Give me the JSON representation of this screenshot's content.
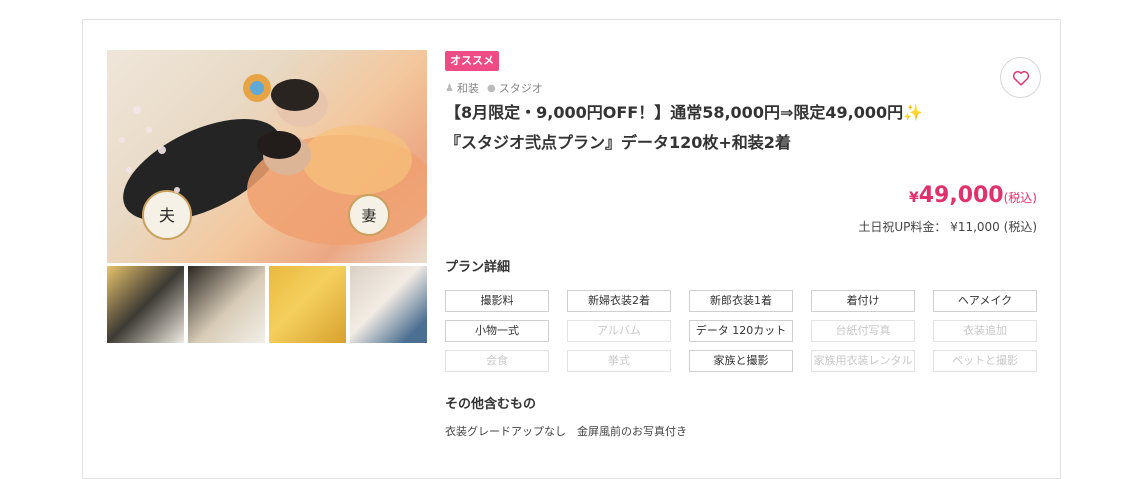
{
  "badge": "オススメ",
  "tags": {
    "costume": "和装",
    "location": "スタジオ"
  },
  "title": {
    "line1": "【8月限定・9,000円OFF！】通常58,000円⇒限定49,000円",
    "sparkle": "✨",
    "line2": "『スタジオ弐点プラン』データ120枚+和装2着"
  },
  "price": {
    "yen": "¥",
    "amount": "49,000",
    "tax": "(税込)"
  },
  "weekend": "土日祝UP料金： ¥11,000 (税込)",
  "plan_title": "プラン詳細",
  "plan_items": [
    {
      "label": "撮影料",
      "included": true
    },
    {
      "label": "新婦衣装2着",
      "included": true
    },
    {
      "label": "新郎衣装1着",
      "included": true
    },
    {
      "label": "着付け",
      "included": true
    },
    {
      "label": "ヘアメイク",
      "included": true
    },
    {
      "label": "小物一式",
      "included": true
    },
    {
      "label": "アルバム",
      "included": false
    },
    {
      "label": "データ 120カット",
      "included": true
    },
    {
      "label": "台紙付写真",
      "included": false
    },
    {
      "label": "衣装追加",
      "included": false
    },
    {
      "label": "会食",
      "included": false
    },
    {
      "label": "挙式",
      "included": false
    },
    {
      "label": "家族と撮影",
      "included": true
    },
    {
      "label": "家族用衣装レンタル",
      "included": false
    },
    {
      "label": "ペットと撮影",
      "included": false
    }
  ],
  "others_title": "その他含むもの",
  "others_text": "衣装グレードアップなし　金屏風前のお写真付き",
  "photo_marks": {
    "left": "夫",
    "right": "妻"
  },
  "colors": {
    "accent": "#ef4b84",
    "price": "#e1306c"
  },
  "icons": {
    "favorite": "heart-outline-icon"
  }
}
